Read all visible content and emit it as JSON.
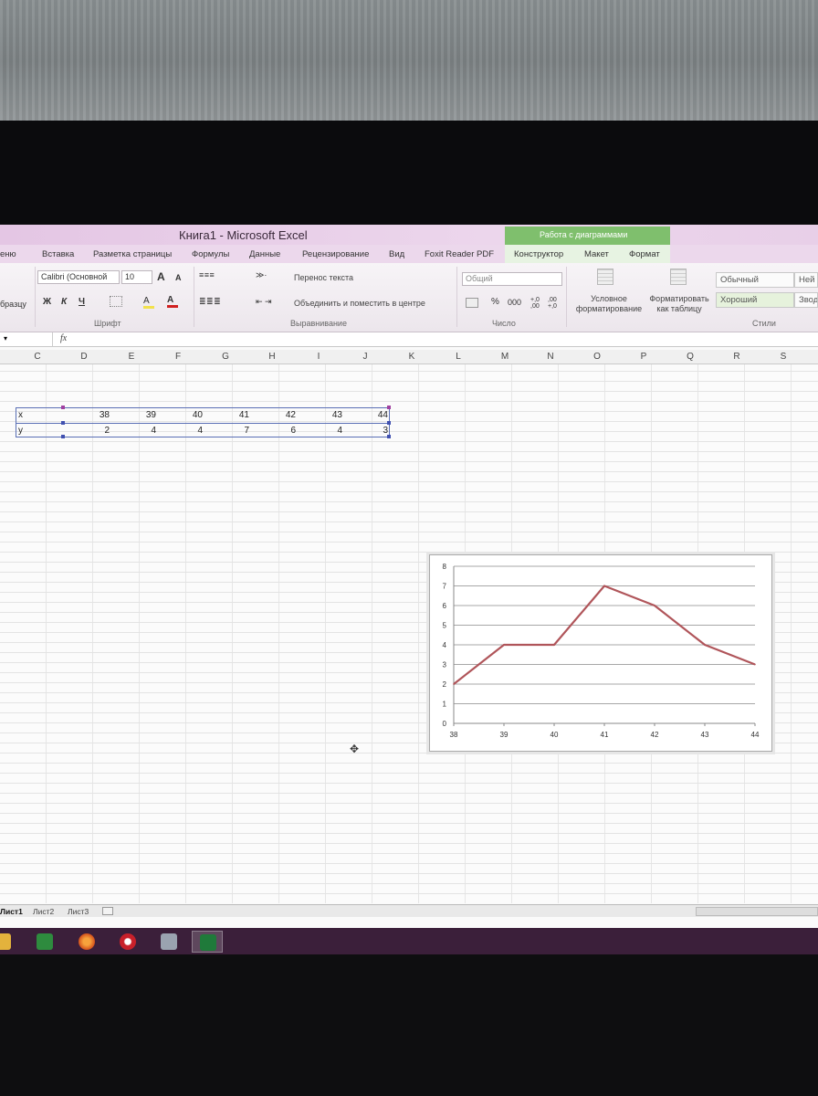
{
  "window": {
    "title": "Книга1  -  Microsoft Excel"
  },
  "context_tab_group": "Работа с диаграммами",
  "ribbon_tabs": [
    "еню",
    "Вставка",
    "Разметка страницы",
    "Формулы",
    "Данные",
    "Рецензирование",
    "Вид",
    "Foxit Reader PDF"
  ],
  "context_tabs": [
    "Конструктор",
    "Макет",
    "Формат"
  ],
  "ribbon": {
    "clipboard": {
      "format_painter": "бразцу"
    },
    "font": {
      "font_name": "Calibri (Основной",
      "font_size": "10",
      "bold": "Ж",
      "italic": "К",
      "underline": "Ч",
      "grow": "A",
      "shrink": "A",
      "fill_color": "A",
      "font_color": "A",
      "group_label": "Шрифт"
    },
    "alignment": {
      "wrap_text": "Перенос текста",
      "merge_center": "Объединить и поместить в центре",
      "group_label": "Выравнивание"
    },
    "number": {
      "format": "Общий",
      "percent": "%",
      "thousands": "000",
      "inc_decimal": "+,0 ,00",
      "dec_decimal": ",00 +,0",
      "group_label": "Число"
    },
    "styles": {
      "conditional": "Условное форматирование",
      "as_table": "Форматировать как таблицу",
      "cells": [
        "Обычный",
        "Ней",
        "Хороший",
        "Звод"
      ],
      "group_label": "Стили"
    }
  },
  "formula_bar": {
    "fx": "fx",
    "value": ""
  },
  "columns": [
    "C",
    "D",
    "E",
    "F",
    "G",
    "H",
    "I",
    "J",
    "K",
    "L",
    "M",
    "N",
    "O",
    "P",
    "Q",
    "R",
    "S"
  ],
  "table": {
    "row_x_label": "x",
    "row_y_label": "y",
    "x": [
      "38",
      "39",
      "40",
      "41",
      "42",
      "43",
      "44"
    ],
    "y": [
      "2",
      "4",
      "4",
      "7",
      "6",
      "4",
      "3"
    ]
  },
  "chart_data": {
    "type": "line",
    "categories": [
      "38",
      "39",
      "40",
      "41",
      "42",
      "43",
      "44"
    ],
    "series": [
      {
        "values": [
          2,
          4,
          4,
          7,
          6,
          4,
          3
        ],
        "color": "#b0555a"
      }
    ],
    "title": "",
    "xlabel": "",
    "ylabel": "",
    "ylim": [
      0,
      8
    ],
    "yticks": [
      "0",
      "1",
      "2",
      "3",
      "4",
      "5",
      "6",
      "7",
      "8"
    ],
    "grid": true,
    "legend": "none"
  },
  "sheets": [
    "Лист1",
    "Лист2",
    "Лист3"
  ],
  "taskbar": [
    "explorer-icon",
    "store-icon",
    "firefox-icon",
    "opera-icon",
    "network-icon",
    "excel-icon"
  ]
}
